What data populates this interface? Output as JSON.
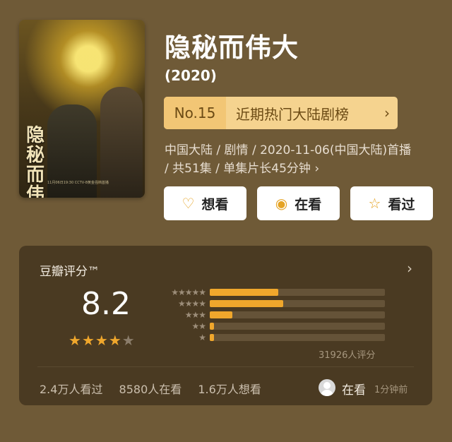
{
  "poster": {
    "title_art": "隐秘而伟大",
    "credits": "11月06日19:30 CCTV-8黄金强档首播",
    "icon": "poster-image"
  },
  "header": {
    "title": "隐秘而伟大",
    "year": "(2020)"
  },
  "ranking": {
    "number": "No.15",
    "label": "近期热门大陆剧榜",
    "chevron": "›"
  },
  "meta": {
    "info": "中国大陆 / 剧情 / 2020-11-06(中国大陆)首播 / 共51集 / 单集片长45分钟 ›"
  },
  "actions": [
    {
      "label": "想看",
      "icon": "heart-plus-icon",
      "glyph": "♡"
    },
    {
      "label": "在看",
      "icon": "target-icon",
      "glyph": "◉"
    },
    {
      "label": "看过",
      "icon": "star-icon",
      "glyph": "☆"
    }
  ],
  "rating": {
    "title": "豆瓣评分™",
    "score": "8.2",
    "stars_filled": 4,
    "stars_total": 5,
    "distribution": [
      {
        "label": "★★★★★",
        "fraction": 0.39
      },
      {
        "label": "★★★★",
        "fraction": 0.42
      },
      {
        "label": "★★★",
        "fraction": 0.13
      },
      {
        "label": "★★",
        "fraction": 0.025
      },
      {
        "label": "★",
        "fraction": 0.025
      }
    ],
    "count": "31926人评分",
    "stats": {
      "watched": "2.4万人看过",
      "watching": "8580人在看",
      "want": "1.6万人想看"
    },
    "status": "在看",
    "status_time": "1分钟前"
  },
  "colors": {
    "background": "#6f5a37",
    "card": "#4a3a22",
    "accent": "#f0a72c",
    "rank_bg": "#f5d38f"
  }
}
